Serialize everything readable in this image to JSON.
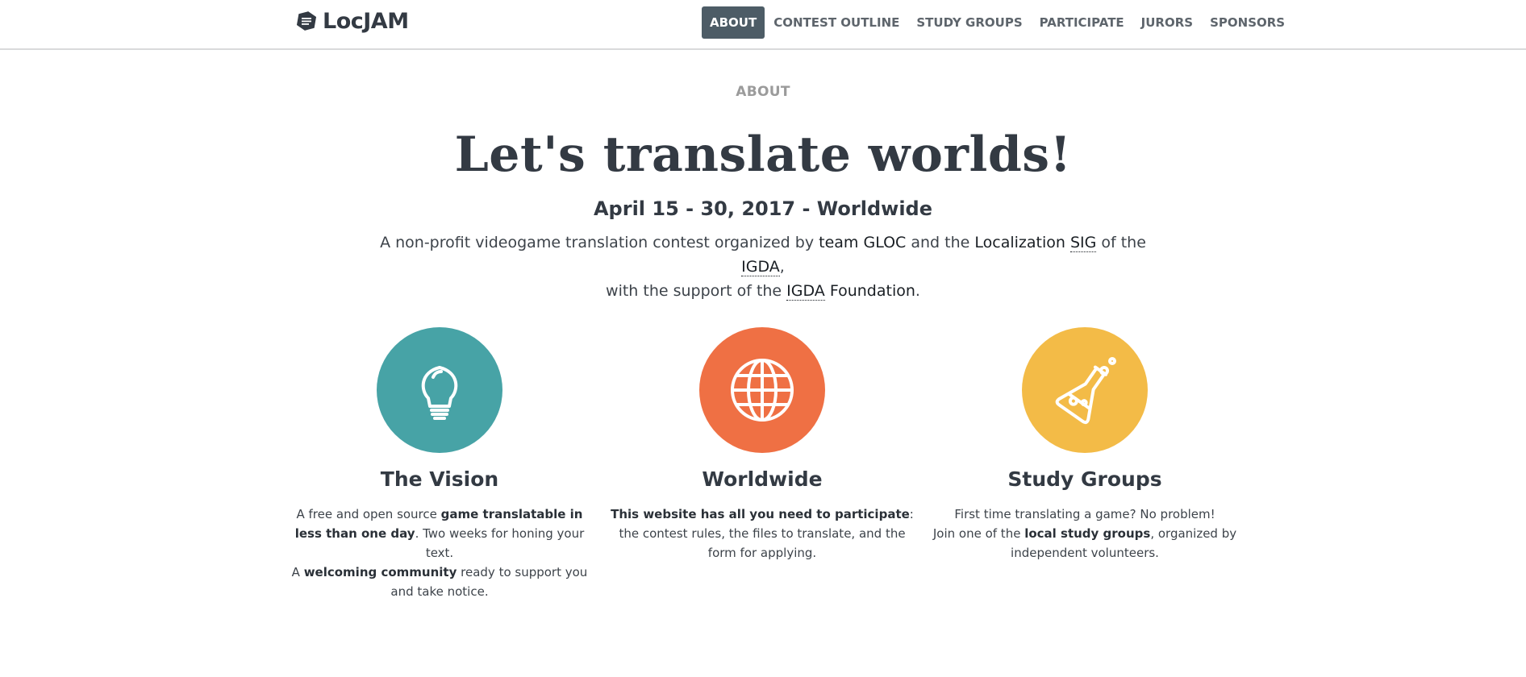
{
  "brand": {
    "name": "LocJAM"
  },
  "nav": {
    "items": [
      {
        "label": "ABOUT",
        "active": true
      },
      {
        "label": "CONTEST OUTLINE"
      },
      {
        "label": "STUDY GROUPS"
      },
      {
        "label": "PARTICIPATE"
      },
      {
        "label": "JURORS"
      },
      {
        "label": "SPONSORS"
      }
    ]
  },
  "intro": {
    "section_label": "ABOUT",
    "title": "Let's translate worlds!",
    "date": "April 15 - 30, 2017 - Worldwide",
    "desc": {
      "t1": "A non-profit videogame translation contest organized by ",
      "link_gloc": "team GLOC",
      "t2": " and the ",
      "link_loc": "Localization ",
      "abbr_sig": "SIG",
      "t3": " of the ",
      "abbr_igda1": "IGDA",
      "t4": ",",
      "t5": "with the support of the ",
      "abbr_igda2": "IGDA",
      "link_found": " Foundation",
      "t6": "."
    }
  },
  "features": [
    {
      "icon": "lightbulb-icon",
      "color": "#47a3a6",
      "title": "The Vision",
      "p1": "A free and open source ",
      "b1": "game translatable in less than one day",
      "p2": ". Two weeks for honing your text.",
      "p3": "A ",
      "b2": "welcoming community",
      "p4": " ready to support you and take notice."
    },
    {
      "icon": "globe-icon",
      "color": "#ef7044",
      "title": "Worldwide",
      "b1": "This website has all you need to participate",
      "p1": ": the contest rules, the files to translate, and the form for applying."
    },
    {
      "icon": "flask-icon",
      "color": "#f3bb47",
      "title": "Study Groups",
      "p1": "First time translating a game? No problem!",
      "p2": "Join one of the ",
      "b1": "local study groups",
      "p3": ", organized by independent volunteers."
    }
  ]
}
